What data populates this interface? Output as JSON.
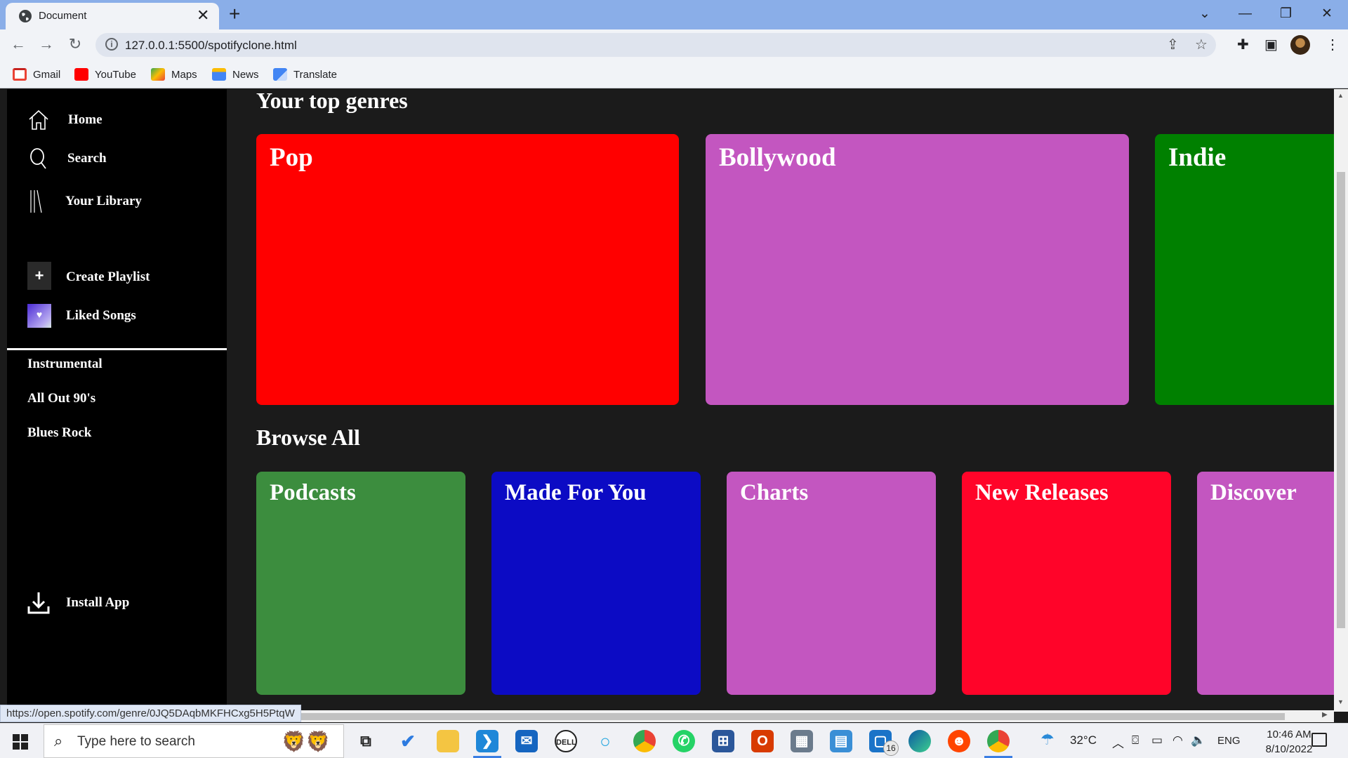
{
  "browser": {
    "tab_title": "Document",
    "url": "127.0.0.1:5500/spotifyclone.html",
    "bookmarks": [
      {
        "label": "Gmail",
        "color": "#ea4335"
      },
      {
        "label": "YouTube",
        "color": "#ff0000"
      },
      {
        "label": "Maps",
        "color": "#34a853"
      },
      {
        "label": "News",
        "color": "#4285f4"
      },
      {
        "label": "Translate",
        "color": "#4285f4"
      }
    ],
    "status_url": "https://open.spotify.com/genre/0JQ5DAqbMKFHCxg5H5PtqW"
  },
  "sidebar": {
    "nav": [
      {
        "label": "Home",
        "icon": "home-icon"
      },
      {
        "label": "Search",
        "icon": "search-icon"
      },
      {
        "label": "Your Library",
        "icon": "library-icon"
      }
    ],
    "create_playlist": "Create Playlist",
    "liked_songs": "Liked Songs",
    "playlists": [
      "Instrumental",
      "All Out 90's",
      "Blues Rock"
    ],
    "install_app": "Install App"
  },
  "main": {
    "top_genres_title": "Your top genres",
    "top_genres": [
      {
        "label": "Pop",
        "color": "#ff0000"
      },
      {
        "label": "Bollywood",
        "color": "#c356c0"
      },
      {
        "label": "Indie",
        "color": "#008000"
      }
    ],
    "browse_title": "Browse All",
    "browse": [
      {
        "label": "Podcasts",
        "color": "#3c8d3e"
      },
      {
        "label": "Made For You",
        "color": "#0c0bc4"
      },
      {
        "label": "Charts",
        "color": "#c356c0"
      },
      {
        "label": "New Releases",
        "color": "#ff0429"
      },
      {
        "label": "Discover",
        "color": "#c356c0"
      }
    ]
  },
  "taskbar": {
    "search_placeholder": "Type here to search",
    "badge_count": "16",
    "weather": "32°C",
    "language": "ENG",
    "time": "10:46 AM",
    "date": "8/10/2022"
  }
}
